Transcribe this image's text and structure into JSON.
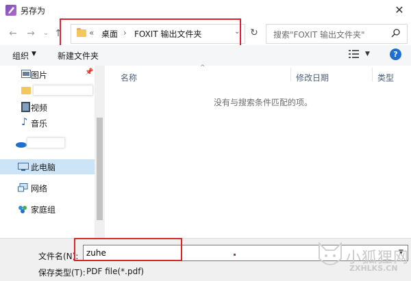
{
  "window": {
    "title": "另存为",
    "close_glyph": "✕"
  },
  "nav": {
    "back_glyph": "←",
    "forward_glyph": "→",
    "recent_glyph": "⌄",
    "up_glyph": "↑",
    "breadcrumb": {
      "overflow": "«",
      "sep": "›",
      "items": [
        "桌面",
        "FOXIT 输出文件夹"
      ]
    },
    "refresh_glyph": "↻",
    "search_placeholder": "搜索\"FOXIT 输出文件夹\""
  },
  "toolbar": {
    "organize_label": "组织",
    "new_folder_label": "新建文件夹",
    "help_label": "?"
  },
  "sidebar": {
    "items": [
      {
        "label": "图片",
        "icon": "pictures-icon"
      },
      {
        "label": "",
        "icon": "folder-icon",
        "redacted": true
      },
      {
        "label": "视频",
        "icon": "video-icon"
      },
      {
        "label": "音乐",
        "icon": "music-icon"
      },
      {
        "label": "",
        "icon": "onedrive-icon",
        "redacted": true
      },
      {
        "label": "此电脑",
        "icon": "this-pc-icon",
        "selected": true
      },
      {
        "label": "网络",
        "icon": "network-icon"
      },
      {
        "label": "家庭组",
        "icon": "homegroup-icon"
      }
    ]
  },
  "file_list": {
    "columns": [
      "名称",
      "修改日期",
      "类型"
    ],
    "empty_message": "没有与搜索条件匹配的项。"
  },
  "save": {
    "filename_label": "文件名(N):",
    "filename_value": "zuhe",
    "filetype_label": "保存类型(T):",
    "filetype_value": "PDF file(*.pdf)"
  },
  "watermark": {
    "text": "小狐狸网",
    "sub": "ZXHLKS.CN"
  },
  "colors": {
    "highlight": "#e0202a",
    "selected_bg": "#cce4f7",
    "help_blue": "#1e6fd1"
  }
}
